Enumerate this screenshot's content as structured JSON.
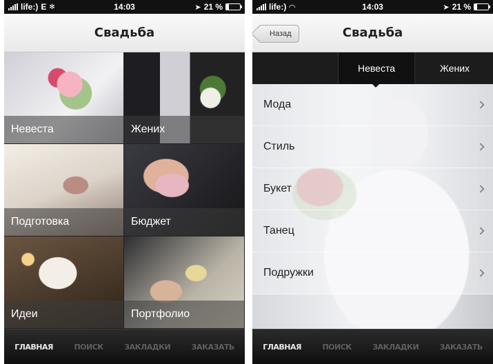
{
  "left": {
    "status": {
      "carrier": "life:)",
      "network": "E",
      "time": "14:03",
      "battery": "21 %"
    },
    "title": "Свадьба",
    "tiles": [
      {
        "label": "Невеста"
      },
      {
        "label": "Жених"
      },
      {
        "label": "Подготовка"
      },
      {
        "label": "Бюджет"
      },
      {
        "label": "Идеи"
      },
      {
        "label": "Портфолио"
      }
    ],
    "tabs": [
      "ГЛАВНАЯ",
      "ПОИСК",
      "ЗАКЛАДКИ",
      "ЗАКАЗАТЬ"
    ]
  },
  "right": {
    "status": {
      "carrier": "life:)",
      "time": "14:03",
      "battery": "21 %"
    },
    "back_label": "Назад",
    "title": "Свадьба",
    "segments": [
      "Невеста",
      "Жених"
    ],
    "menu": [
      "Мода",
      "Стиль",
      "Букет",
      "Танец",
      "Подружки"
    ],
    "tabs": [
      "ГЛАВНАЯ",
      "ПОИСК",
      "ЗАКЛАДКИ",
      "ЗАКАЗАТЬ"
    ]
  },
  "colors": {
    "tabbar": "#1a1a1a",
    "active_tab": "#e8e8e8",
    "inactive_tab": "#5f5f5f",
    "segment_bg": "#1c1c1c"
  },
  "icons": {
    "signal": "signal-bars-icon",
    "location": "location-arrow-icon",
    "battery": "battery-icon",
    "wifi": "wifi-icon",
    "network_activity": "spinner-icon"
  }
}
